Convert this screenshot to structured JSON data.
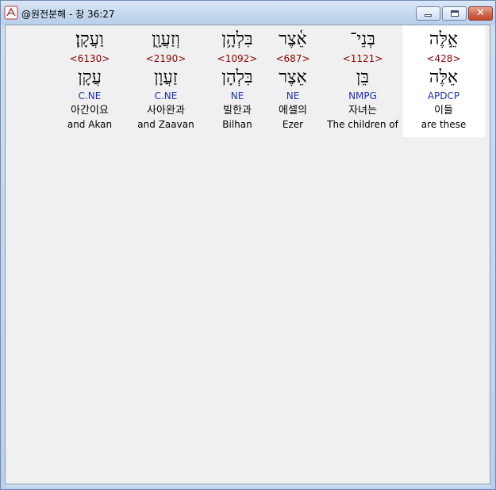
{
  "window": {
    "title": "@원전분해 - 창 36:27",
    "close_glyph": "✕"
  },
  "words": [
    {
      "hebrew": "אֵ֣לֶּה",
      "strong": "<428>",
      "lemma": "אֵלֶּה",
      "morph": "APDCP",
      "korean": "이들",
      "english": "are these",
      "selected": true
    },
    {
      "hebrew": "בְּנֵי־",
      "strong": "<1121>",
      "lemma": "בֵּן",
      "morph": "NMPG",
      "korean": "자녀는",
      "english": "The children of",
      "selected": false
    },
    {
      "hebrew": "אֵ֫צֶר",
      "strong": "<687>",
      "lemma": "אֵצֶר",
      "morph": "NE",
      "korean": "에셀의",
      "english": "Ezer",
      "selected": false
    },
    {
      "hebrew": "בִּלְהָ֥ן",
      "strong": "<1092>",
      "lemma": "בִּלְהָן",
      "morph": "NE",
      "korean": "빌한과",
      "english": "Bilhan",
      "selected": false
    },
    {
      "hebrew": "וְזַעֲוָ֖ן",
      "strong": "<2190>",
      "lemma": "זַעֲוָן",
      "morph": "C.NE",
      "korean": "사아완과",
      "english": "and Zaavan",
      "selected": false
    },
    {
      "hebrew": "וַעֲקָֽן׃",
      "strong": "<6130>",
      "lemma": "עֲקָן",
      "morph": "C.NE",
      "korean": "아간이요",
      "english": "and Akan",
      "selected": false
    }
  ]
}
